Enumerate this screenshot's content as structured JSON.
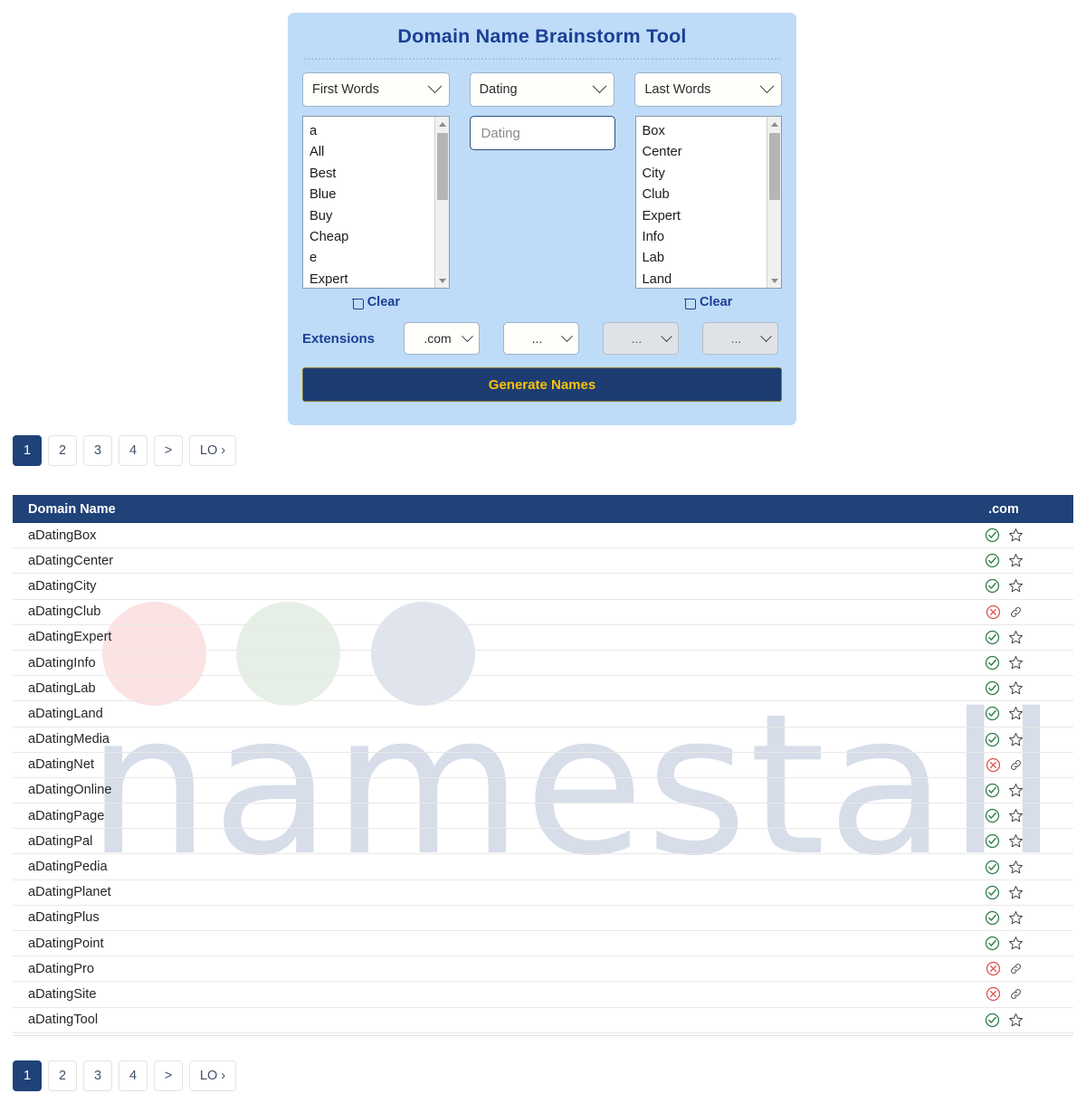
{
  "panel": {
    "title": "Domain Name Brainstorm Tool",
    "selects": [
      {
        "name": "first-words",
        "value": "First Words"
      },
      {
        "name": "keyword",
        "value": "Dating"
      },
      {
        "name": "last-words",
        "value": "Last Words"
      }
    ],
    "first_words_list": [
      "a",
      "All",
      "Best",
      "Blue",
      "Buy",
      "Cheap",
      "e",
      "Expert"
    ],
    "keyword_input": {
      "placeholder": "Dating",
      "value": ""
    },
    "last_words_list": [
      "Box",
      "Center",
      "City",
      "Club",
      "Expert",
      "Info",
      "Lab",
      "Land"
    ],
    "clear_left_label": "Clear",
    "clear_right_label": "Clear",
    "extensions_label": "Extensions",
    "extensions": [
      ".com",
      "...",
      "...",
      "..."
    ],
    "generate_label": "Generate Names"
  },
  "pagination": {
    "pages": [
      "1",
      "2",
      "3",
      "4",
      ">",
      "LO ›"
    ],
    "active": "1"
  },
  "table": {
    "headers": {
      "name": "Domain Name",
      "extension": ".com"
    },
    "rows": [
      {
        "domain": "aDatingBox",
        "status": "available"
      },
      {
        "domain": "aDatingCenter",
        "status": "available"
      },
      {
        "domain": "aDatingCity",
        "status": "available"
      },
      {
        "domain": "aDatingClub",
        "status": "taken"
      },
      {
        "domain": "aDatingExpert",
        "status": "available"
      },
      {
        "domain": "aDatingInfo",
        "status": "available"
      },
      {
        "domain": "aDatingLab",
        "status": "available"
      },
      {
        "domain": "aDatingLand",
        "status": "available"
      },
      {
        "domain": "aDatingMedia",
        "status": "available"
      },
      {
        "domain": "aDatingNet",
        "status": "taken"
      },
      {
        "domain": "aDatingOnline",
        "status": "available"
      },
      {
        "domain": "aDatingPage",
        "status": "available"
      },
      {
        "domain": "aDatingPal",
        "status": "available"
      },
      {
        "domain": "aDatingPedia",
        "status": "available"
      },
      {
        "domain": "aDatingPlanet",
        "status": "available"
      },
      {
        "domain": "aDatingPlus",
        "status": "available"
      },
      {
        "domain": "aDatingPoint",
        "status": "available"
      },
      {
        "domain": "aDatingPro",
        "status": "taken"
      },
      {
        "domain": "aDatingSite",
        "status": "taken"
      },
      {
        "domain": "aDatingTool",
        "status": "available"
      }
    ]
  },
  "watermark": {
    "text": "namestall"
  },
  "colors": {
    "panel_bg": "#bedcf8",
    "navy": "#1f4278",
    "title_blue": "#1c3f94",
    "generate_bg": "#1c3c72",
    "generate_text": "#ffc107",
    "available_green": "#2e7d47",
    "taken_red": "#d9534f",
    "watermark": "#d7dde9"
  }
}
